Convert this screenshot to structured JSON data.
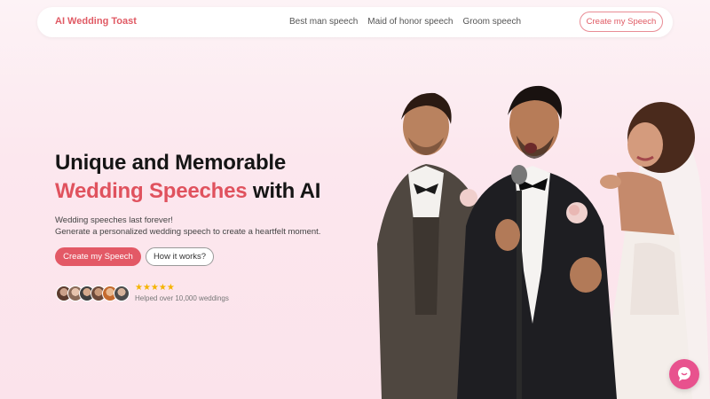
{
  "nav": {
    "brand": "AI Wedding Toast",
    "links": [
      "Best man speech",
      "Maid of honor speech",
      "Groom speech"
    ],
    "cta": "Create my Speech"
  },
  "hero": {
    "title_line1": "Unique and Memorable",
    "title_accent": "Wedding Speeches",
    "title_rest": " with AI",
    "subtitle_line1": "Wedding speeches last forever!",
    "subtitle_line2": "Generate a personalized wedding speech to create a heartfelt moment.",
    "primary_button": "Create my Speech",
    "secondary_button": "How it works?",
    "rating_stars": "★★★★★",
    "rating": 5,
    "helped_text": "Helped over 10,000 weddings"
  },
  "colors": {
    "accent": "#e0525e",
    "chat_button": "#e8528e",
    "star": "#f4b400"
  },
  "icons": {
    "chat": "chat-bubble-icon"
  }
}
